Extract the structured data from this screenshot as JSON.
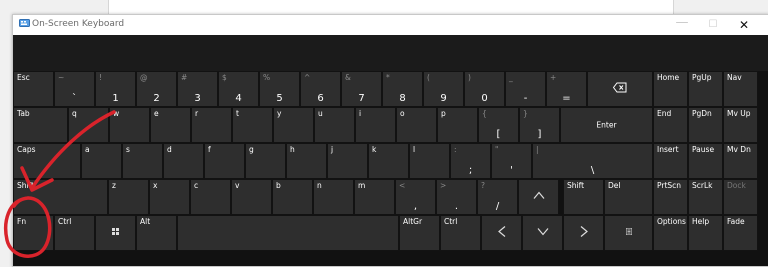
{
  "window": {
    "title": "On-Screen Keyboard"
  },
  "title_buttons": {
    "minimize": "—",
    "maximize": "☐",
    "close": "✕"
  },
  "rows": [
    [
      {
        "name": "esc",
        "label": "Esc"
      },
      {
        "name": "backtick",
        "shift": "~",
        "main": "`"
      },
      {
        "name": "1",
        "shift": "!",
        "main": "1"
      },
      {
        "name": "2",
        "shift": "@",
        "main": "2"
      },
      {
        "name": "3",
        "shift": "#",
        "main": "3"
      },
      {
        "name": "4",
        "shift": "$",
        "main": "4"
      },
      {
        "name": "5",
        "shift": "%",
        "main": "5"
      },
      {
        "name": "6",
        "shift": "^",
        "main": "6"
      },
      {
        "name": "7",
        "shift": "&",
        "main": "7"
      },
      {
        "name": "8",
        "shift": "*",
        "main": "8"
      },
      {
        "name": "9",
        "shift": "(",
        "main": "9"
      },
      {
        "name": "0",
        "shift": ")",
        "main": "0"
      },
      {
        "name": "minus",
        "shift": "_",
        "main": "-"
      },
      {
        "name": "equals",
        "shift": "+",
        "main": "="
      },
      {
        "name": "backspace",
        "icon": "backspace-icon"
      }
    ],
    [
      {
        "name": "tab",
        "label": "Tab"
      },
      {
        "name": "q",
        "label": "q"
      },
      {
        "name": "w",
        "label": "w"
      },
      {
        "name": "e",
        "label": "e"
      },
      {
        "name": "r",
        "label": "r"
      },
      {
        "name": "t",
        "label": "t"
      },
      {
        "name": "y",
        "label": "y"
      },
      {
        "name": "u",
        "label": "u"
      },
      {
        "name": "i",
        "label": "i"
      },
      {
        "name": "o",
        "label": "o"
      },
      {
        "name": "p",
        "label": "p"
      },
      {
        "name": "open-bracket",
        "shift": "{",
        "main": "["
      },
      {
        "name": "close-bracket",
        "shift": "}",
        "main": "]"
      },
      {
        "name": "enter",
        "center": "Enter"
      }
    ],
    [
      {
        "name": "caps",
        "label": "Caps"
      },
      {
        "name": "a",
        "label": "a"
      },
      {
        "name": "s",
        "label": "s"
      },
      {
        "name": "d",
        "label": "d"
      },
      {
        "name": "f",
        "label": "f"
      },
      {
        "name": "g",
        "label": "g"
      },
      {
        "name": "h",
        "label": "h"
      },
      {
        "name": "j",
        "label": "j"
      },
      {
        "name": "k",
        "label": "k"
      },
      {
        "name": "l",
        "label": "l"
      },
      {
        "name": "semicolon",
        "shift": ":",
        "main": ";"
      },
      {
        "name": "quote",
        "shift": "\"",
        "main": "'"
      },
      {
        "name": "backslash",
        "shift": "|",
        "main": "\\"
      }
    ],
    [
      {
        "name": "shift-left",
        "label": "Shift"
      },
      {
        "name": "z",
        "label": "z"
      },
      {
        "name": "x",
        "label": "x"
      },
      {
        "name": "c",
        "label": "c"
      },
      {
        "name": "v",
        "label": "v"
      },
      {
        "name": "b",
        "label": "b"
      },
      {
        "name": "n",
        "label": "n"
      },
      {
        "name": "m",
        "label": "m"
      },
      {
        "name": "comma",
        "shift": "<",
        "main": ","
      },
      {
        "name": "period",
        "shift": ">",
        "main": "."
      },
      {
        "name": "slash",
        "shift": "?",
        "main": "/"
      },
      {
        "name": "arrow-up",
        "icon": "arrow-up-icon"
      },
      {
        "name": "shift-right",
        "label": "Shift"
      },
      {
        "name": "del",
        "label": "Del"
      }
    ],
    [
      {
        "name": "fn",
        "label": "Fn"
      },
      {
        "name": "ctrl-left",
        "label": "Ctrl"
      },
      {
        "name": "windows",
        "icon": "windows-icon"
      },
      {
        "name": "alt",
        "label": "Alt"
      },
      {
        "name": "space",
        "label": ""
      },
      {
        "name": "altgr",
        "label": "AltGr"
      },
      {
        "name": "ctrl-right",
        "label": "Ctrl"
      },
      {
        "name": "arrow-left",
        "icon": "arrow-left-icon"
      },
      {
        "name": "arrow-down",
        "icon": "arrow-down-icon"
      },
      {
        "name": "arrow-right",
        "icon": "arrow-right-icon"
      },
      {
        "name": "menu",
        "icon": "menu-icon"
      }
    ]
  ],
  "side_keys": [
    {
      "name": "home",
      "label": "Home"
    },
    {
      "name": "pgup",
      "label": "PgUp"
    },
    {
      "name": "nav",
      "label": "Nav"
    },
    {
      "name": "end",
      "label": "End"
    },
    {
      "name": "pgdn",
      "label": "PgDn"
    },
    {
      "name": "mvup",
      "label": "Mv Up"
    },
    {
      "name": "insert",
      "label": "Insert"
    },
    {
      "name": "pause",
      "label": "Pause"
    },
    {
      "name": "mvdn",
      "label": "Mv Dn"
    },
    {
      "name": "prtscn",
      "label": "PrtScn"
    },
    {
      "name": "scrlk",
      "label": "ScrLk"
    },
    {
      "name": "dock",
      "label": "Dock",
      "dim": true
    },
    {
      "name": "options",
      "label": "Options"
    },
    {
      "name": "help",
      "label": "Help"
    },
    {
      "name": "fade",
      "label": "Fade"
    }
  ],
  "colors": {
    "key_background": "#2e2e2e",
    "keyboard_background": "#111111",
    "annotation": "#d9232b"
  }
}
